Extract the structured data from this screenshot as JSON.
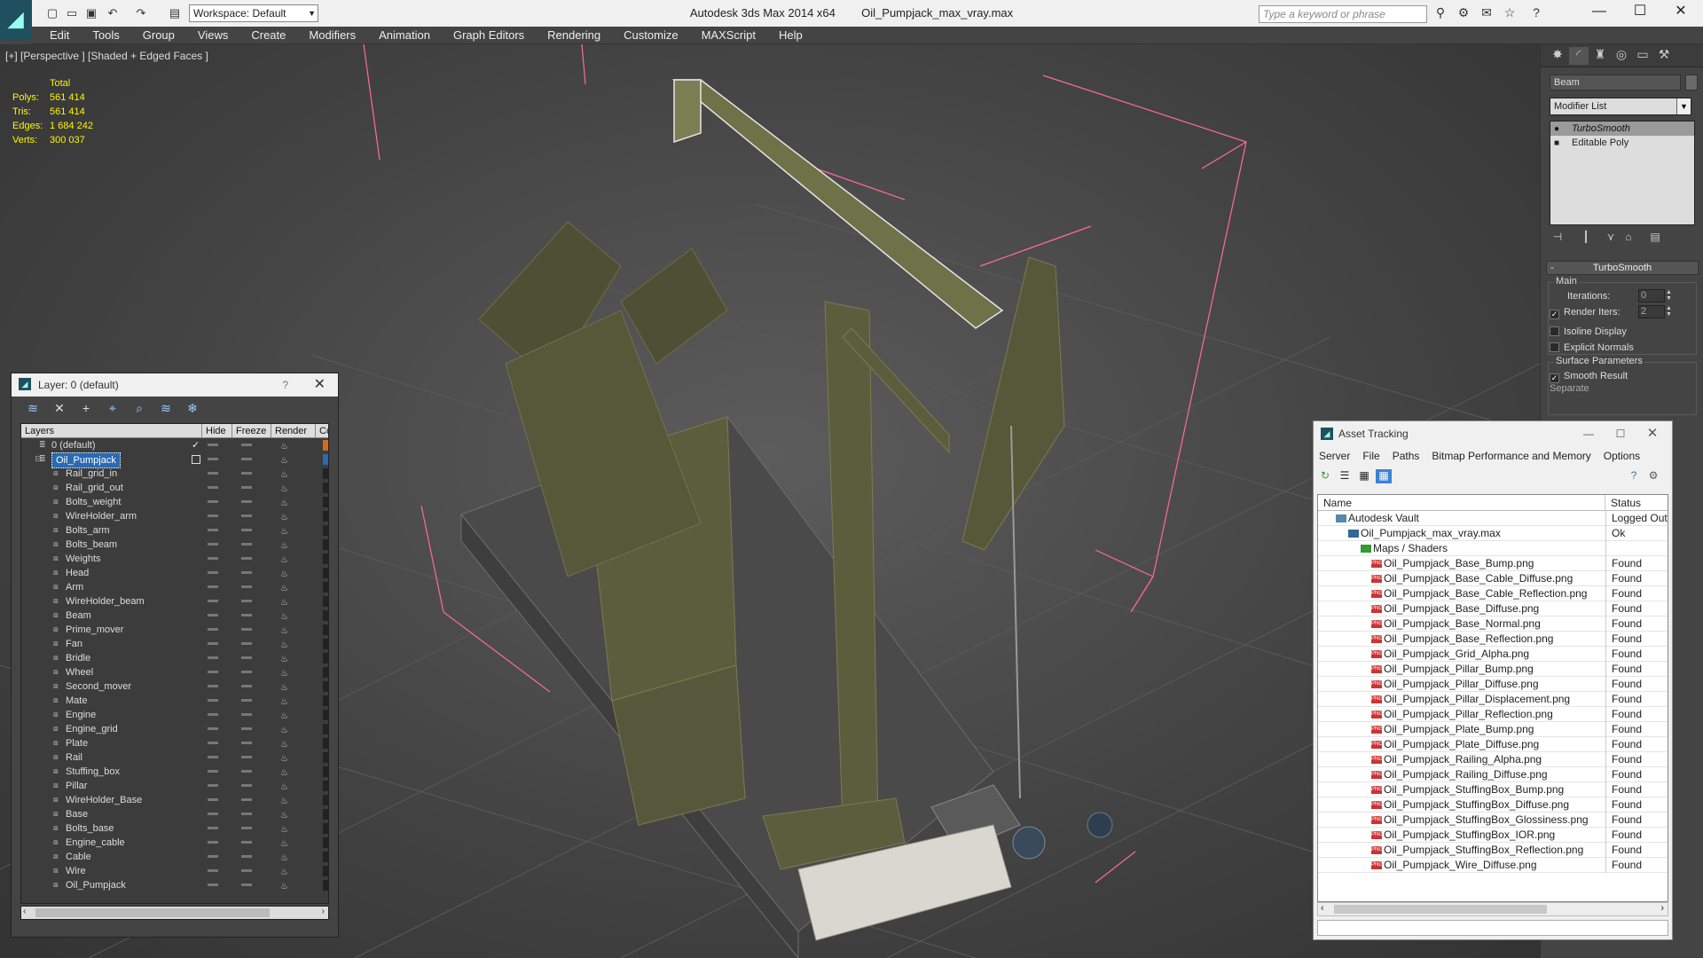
{
  "titlebar": {
    "app": "Autodesk 3ds Max  2014 x64",
    "file": "Oil_Pumpjack_max_vray.max",
    "workspace": "Workspace: Default",
    "search_placeholder": "Type a keyword or phrase"
  },
  "menu": [
    "Edit",
    "Tools",
    "Group",
    "Views",
    "Create",
    "Modifiers",
    "Animation",
    "Graph Editors",
    "Rendering",
    "Customize",
    "MAXScript",
    "Help"
  ],
  "viewport": {
    "label": "[+] [Perspective ] [Shaded + Edged Faces ]",
    "stats": {
      "total_label": "Total",
      "rows": [
        {
          "k": "Polys:",
          "v": "561 414"
        },
        {
          "k": "Tris:",
          "v": "561 414"
        },
        {
          "k": "Edges:",
          "v": "1 684 242"
        },
        {
          "k": "Verts:",
          "v": "300 037"
        }
      ]
    }
  },
  "command_panel": {
    "object_name": "Beam",
    "modifier_list": "Modifier List",
    "stack": [
      "TurboSmooth",
      "Editable Poly"
    ],
    "rollout_title": "TurboSmooth",
    "main_group": "Main",
    "iterations_label": "Iterations:",
    "iterations_value": "0",
    "render_iters_label": "Render Iters:",
    "render_iters_value": "2",
    "isoline_label": "Isoline Display",
    "explicit_label": "Explicit Normals",
    "surface_group": "Surface Parameters",
    "smooth_result_label": "Smooth Result",
    "separate_label": "Separate"
  },
  "layers_panel": {
    "title": "Layer: 0 (default)",
    "help": "?",
    "columns": {
      "layers": "Layers",
      "hide": "Hide",
      "freeze": "Freeze",
      "render": "Render",
      "color": "Co"
    },
    "rows": [
      "0 (default)",
      "Oil_Pumpjack",
      "Rail_grid_in",
      "Rail_grid_out",
      "Bolts_weight",
      "WireHolder_arm",
      "Bolts_arm",
      "Bolts_beam",
      "Weights",
      "Head",
      "Arm",
      "WireHolder_beam",
      "Beam",
      "Prime_mover",
      "Fan",
      "Bridle",
      "Wheel",
      "Second_mover",
      "Mate",
      "Engine",
      "Engine_grid",
      "Plate",
      "Rail",
      "Stuffing_box",
      "Pillar",
      "WireHolder_Base",
      "Base",
      "Bolts_base",
      "Engine_cable",
      "Cable",
      "Wire",
      "Oil_Pumpjack"
    ]
  },
  "asset_tracking": {
    "title": "Asset Tracking",
    "menu": [
      "Server",
      "File",
      "Paths",
      "Bitmap Performance and Memory",
      "Options"
    ],
    "columns": {
      "name": "Name",
      "status": "Status"
    },
    "rows": [
      {
        "name": "Autodesk Vault",
        "status": "Logged Out",
        "level": 0,
        "kind": "vault"
      },
      {
        "name": "Oil_Pumpjack_max_vray.max",
        "status": "Ok",
        "level": 1,
        "kind": "max"
      },
      {
        "name": "Maps / Shaders",
        "status": "",
        "level": 2,
        "kind": "maps"
      },
      {
        "name": "Oil_Pumpjack_Base_Bump.png",
        "status": "Found",
        "level": 3,
        "kind": "png"
      },
      {
        "name": "Oil_Pumpjack_Base_Cable_Diffuse.png",
        "status": "Found",
        "level": 3,
        "kind": "png"
      },
      {
        "name": "Oil_Pumpjack_Base_Cable_Reflection.png",
        "status": "Found",
        "level": 3,
        "kind": "png"
      },
      {
        "name": "Oil_Pumpjack_Base_Diffuse.png",
        "status": "Found",
        "level": 3,
        "kind": "png"
      },
      {
        "name": "Oil_Pumpjack_Base_Normal.png",
        "status": "Found",
        "level": 3,
        "kind": "png"
      },
      {
        "name": "Oil_Pumpjack_Base_Reflection.png",
        "status": "Found",
        "level": 3,
        "kind": "png"
      },
      {
        "name": "Oil_Pumpjack_Grid_Alpha.png",
        "status": "Found",
        "level": 3,
        "kind": "png"
      },
      {
        "name": "Oil_Pumpjack_Pillar_Bump.png",
        "status": "Found",
        "level": 3,
        "kind": "png"
      },
      {
        "name": "Oil_Pumpjack_Pillar_Diffuse.png",
        "status": "Found",
        "level": 3,
        "kind": "png"
      },
      {
        "name": "Oil_Pumpjack_Pillar_Displacement.png",
        "status": "Found",
        "level": 3,
        "kind": "png"
      },
      {
        "name": "Oil_Pumpjack_Pillar_Reflection.png",
        "status": "Found",
        "level": 3,
        "kind": "png"
      },
      {
        "name": "Oil_Pumpjack_Plate_Bump.png",
        "status": "Found",
        "level": 3,
        "kind": "png"
      },
      {
        "name": "Oil_Pumpjack_Plate_Diffuse.png",
        "status": "Found",
        "level": 3,
        "kind": "png"
      },
      {
        "name": "Oil_Pumpjack_Railing_Alpha.png",
        "status": "Found",
        "level": 3,
        "kind": "png"
      },
      {
        "name": "Oil_Pumpjack_Railing_Diffuse.png",
        "status": "Found",
        "level": 3,
        "kind": "png"
      },
      {
        "name": "Oil_Pumpjack_StuffingBox_Bump.png",
        "status": "Found",
        "level": 3,
        "kind": "png"
      },
      {
        "name": "Oil_Pumpjack_StuffingBox_Diffuse.png",
        "status": "Found",
        "level": 3,
        "kind": "png"
      },
      {
        "name": "Oil_Pumpjack_StuffingBox_Glossiness.png",
        "status": "Found",
        "level": 3,
        "kind": "png"
      },
      {
        "name": "Oil_Pumpjack_StuffingBox_IOR.png",
        "status": "Found",
        "level": 3,
        "kind": "png"
      },
      {
        "name": "Oil_Pumpjack_StuffingBox_Reflection.png",
        "status": "Found",
        "level": 3,
        "kind": "png"
      },
      {
        "name": "Oil_Pumpjack_Wire_Diffuse.png",
        "status": "Found",
        "level": 3,
        "kind": "png"
      }
    ]
  },
  "colors": {
    "stats_yellow": "#fff600",
    "selection_blue": "#2a6ab0",
    "bbox_pink": "#ff6a9a",
    "model_olive": "#5b5e3c"
  }
}
